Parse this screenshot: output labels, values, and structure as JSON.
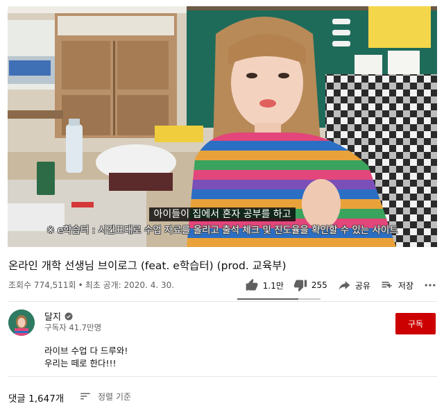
{
  "video": {
    "subtitle_line1": "아이들이 집에서 혼자 공부를 하고",
    "subtitle_line2": "※ e학습터 : 시간표대로 수업 자료를 올리고 출석 체크 및 진도율을 확인할 수 있는 사이트"
  },
  "title": "온라인 개학 선생님 브이로그 (feat. e학습터) (prod. 교육부)",
  "meta": {
    "views": "조회수 774,511회",
    "separator": "•",
    "published": "최초 공개: 2020. 4. 30."
  },
  "actions": {
    "like_count": "1.1만",
    "dislike_count": "255",
    "share_label": "공유",
    "save_label": "저장",
    "like_ratio": 0.73
  },
  "channel": {
    "name": "달지",
    "subscribers": "구독자 41.7만명",
    "subscribe_label": "구독",
    "description_line1": "라이브 수업 다 드루와!",
    "description_line2": "우리는 떼로 한다!!!"
  },
  "comments": {
    "count": "댓글 1,647개",
    "sort_label": "정렬 기준"
  },
  "colors": {
    "subscribe": "#cc0000",
    "text_primary": "#0f0f0f",
    "text_secondary": "#606060",
    "chalkboard": "#1f6b5a"
  }
}
